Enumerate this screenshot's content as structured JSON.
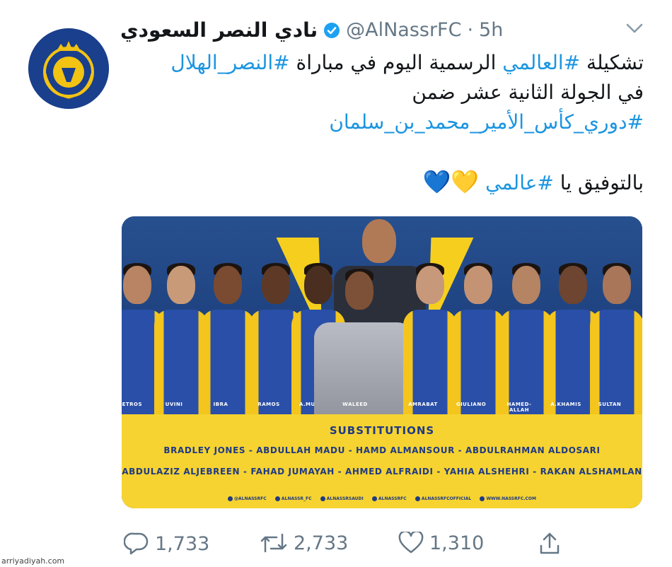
{
  "tweet": {
    "display_name": "نادي النصر السعودي",
    "handle": "@AlNassrFC",
    "separator": "·",
    "time": "5h",
    "text": {
      "l1_pre": "تشكيلة ",
      "l1_tag1": "#العالمي",
      "l1_mid": " الرسمية اليوم في مباراة ",
      "l1_tag2": "#النصر_الهلال",
      "l2": "في الجولة الثانية عشر ضمن",
      "l3_tag": "#دوري_كأس_الأمير_محمد_بن_سلمان",
      "l4_pre": "بالتوفيق يا ",
      "l4_tag": "#عالمي",
      "l4_hearts": "💛💙"
    }
  },
  "media": {
    "players": [
      {
        "name": "PETROS"
      },
      {
        "name": "UVINI"
      },
      {
        "name": "IBRA"
      },
      {
        "name": "RAMOS"
      },
      {
        "name": "A.MUSA"
      },
      {
        "name": "WALEED"
      },
      {
        "name": "AMRABAT"
      },
      {
        "name": "GIULIANO"
      },
      {
        "name": "HAMED-ALLAH"
      },
      {
        "name": "A.KHAMIS"
      },
      {
        "name": "SULTAN"
      }
    ],
    "subs_title": "SUBSTITUTIONS",
    "subs_line1": "BRADLEY JONES - ABDULLAH MADU - HAMD ALMANSOUR - ABDULRAHMAN ALDOSARI",
    "subs_line2": "ABDULAZIZ ALJEBREEN - FAHAD JUMAYAH - AHMED ALFRAIDI - YAHIA ALSHEHRI - RAKAN ALSHAMLAN",
    "social": [
      "@ALNASSRFC",
      "ALNASSR_FC",
      "ALNASSRSAUDI",
      "ALNASSRFC",
      "ALNASSRFCOFFICIAL",
      "WWW.NASSRFC.COM"
    ]
  },
  "actions": {
    "reply_count": "1,733",
    "retweet_count": "2,733",
    "like_count": "1,310"
  },
  "watermark": "arriyadiyah.com",
  "colors": {
    "link": "#1b95e0",
    "muted": "#657786",
    "club_blue": "#1f3a85",
    "club_yellow": "#f6d330"
  }
}
